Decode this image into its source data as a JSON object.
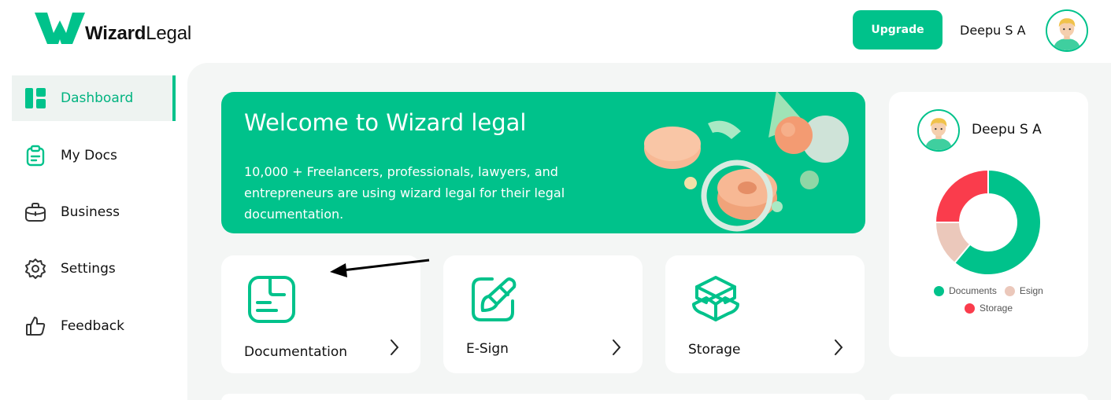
{
  "brand": {
    "name_bold": "Wizard",
    "name_regular": "Legal",
    "color": "#00c28b"
  },
  "header": {
    "upgrade_label": "Upgrade",
    "user_name": "Deepu S A"
  },
  "sidebar": {
    "items": [
      {
        "label": "Dashboard",
        "icon": "dashboard-icon",
        "active": true
      },
      {
        "label": "My Docs",
        "icon": "clipboard-icon",
        "active": false
      },
      {
        "label": "Business",
        "icon": "briefcase-icon",
        "active": false
      },
      {
        "label": "Settings",
        "icon": "gear-icon",
        "active": false
      },
      {
        "label": "Feedback",
        "icon": "thumbs-up-icon",
        "active": false
      }
    ]
  },
  "banner": {
    "title": "Welcome to Wizard legal",
    "text": "10,000 + Freelancers, professionals, lawyers, and entrepreneurs are using wizard legal for their legal documentation."
  },
  "cards": [
    {
      "label": "Documentation",
      "icon": "document-icon"
    },
    {
      "label": "E-Sign",
      "icon": "pen-icon"
    },
    {
      "label": "Storage",
      "icon": "cube-icon"
    }
  ],
  "profile_panel": {
    "user_name": "Deepu S A",
    "chart_data": {
      "type": "pie",
      "categories": [
        "Documents",
        "Esign",
        "Storage"
      ],
      "values": [
        61,
        14,
        25
      ],
      "colors": [
        "#00c28b",
        "#ebc8bb",
        "#fa3c4c"
      ]
    }
  }
}
